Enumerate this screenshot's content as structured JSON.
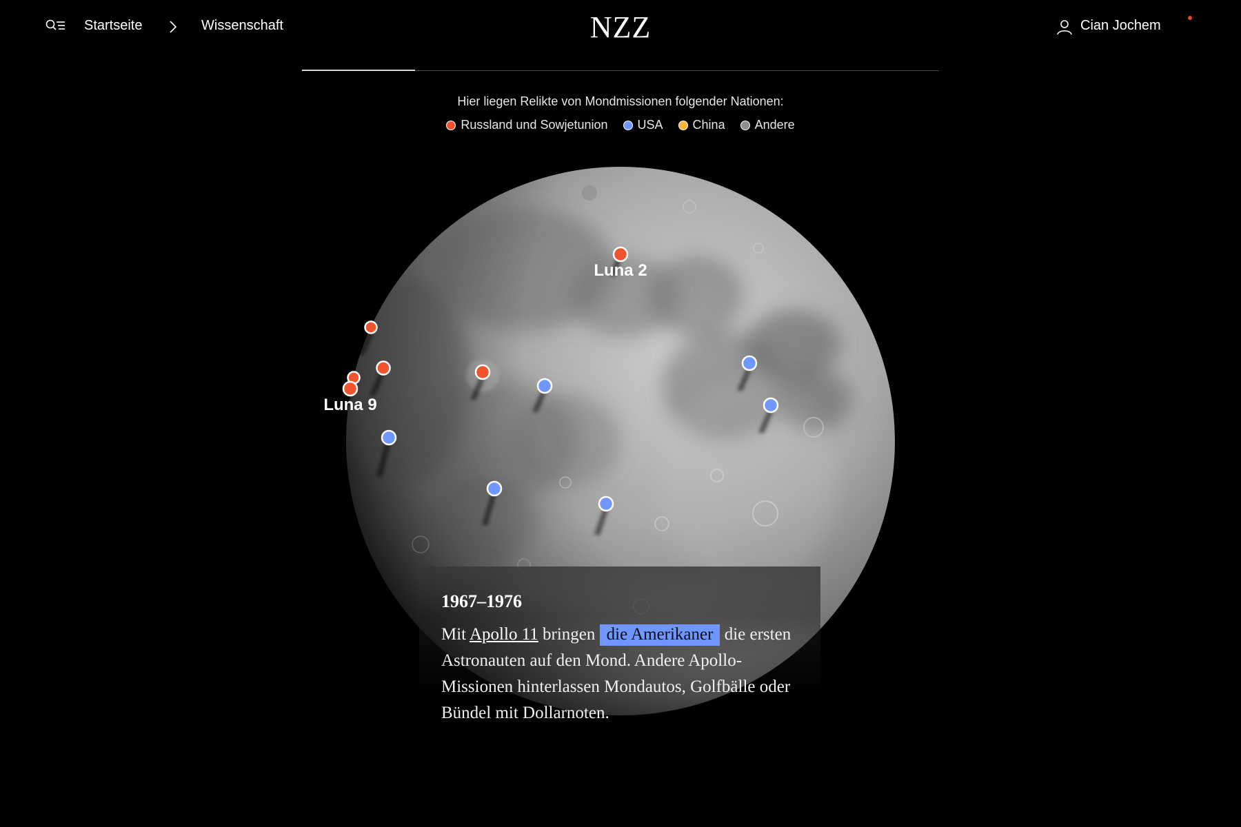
{
  "header": {
    "breadcrumb_home": "Startseite",
    "breadcrumb_section": "Wissenschaft",
    "logo": "NZZ",
    "user_name": "Cian Jochem",
    "notification_color": "#e6443a"
  },
  "progress": {
    "fraction": 0.178
  },
  "legend": {
    "title": "Hier liegen Relikte von Mondmissionen folgender Nationen:",
    "items": [
      {
        "label": "Russland und Sowjetunion",
        "color": "#f0542f"
      },
      {
        "label": "USA",
        "color": "#6f97ff"
      },
      {
        "label": "China",
        "color": "#f5b53a"
      },
      {
        "label": "Andere",
        "color": "#8f8f8f"
      }
    ]
  },
  "moon": {
    "labels": {
      "luna2": "Luna 2",
      "luna9": "Luna 9"
    }
  },
  "story": {
    "date": "1967–1976",
    "text_before": "Mit ",
    "link": "Apollo 11",
    "text_mid": " bringen ",
    "highlight": "die Amerikaner",
    "text_after": " die ersten Astronauten auf den Mond. Andere Apollo-Missionen hinterlassen Mondautos, Golfbälle oder Bündel mit Dollarnoten."
  }
}
